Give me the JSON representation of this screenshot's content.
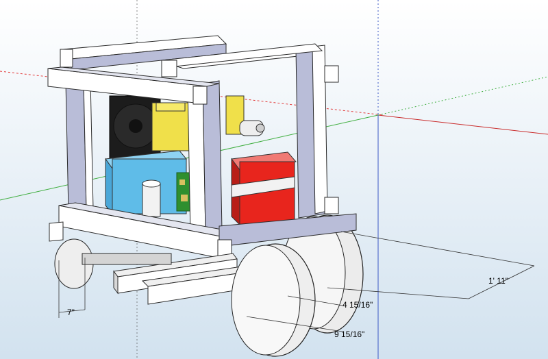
{
  "viewport": {
    "background": "#dbe8f2",
    "sky_top": "#ffffff",
    "sky_bottom": "#d6e5f0"
  },
  "colors": {
    "frame": "#b9bdd8",
    "frame_face": "#ffffff",
    "frame_edge": "#2b2b2b",
    "fan": "#1c1c1c",
    "motor": "#f0e04a",
    "blue_box": "#5fbce8",
    "battery": "#e8251d",
    "battery_label": "#f2f2f2",
    "pcb": "#2f8f2f",
    "wheel": "#eeeeee",
    "axis_red": "#e23b3b",
    "axis_green": "#3fae3f",
    "axis_blue": "#3a56c4"
  },
  "dimensions": [
    {
      "label": "1' 11\"",
      "name": "length-dimension"
    },
    {
      "label": "4 15/16\"",
      "name": "wheel-height-dimension"
    },
    {
      "label": "9 15/16\"",
      "name": "wheel-diameter-dimension"
    },
    {
      "label": "7\"",
      "name": "axle-offset-dimension"
    }
  ]
}
